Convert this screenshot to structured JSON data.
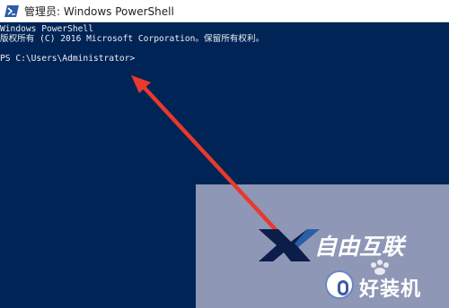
{
  "window": {
    "title": "管理员: Windows PowerShell"
  },
  "console": {
    "lines": [
      "Windows PowerShell",
      "版权所有 (C) 2016 Microsoft Corporation。保留所有权利。",
      "PS C:\\Users\\Administrator>"
    ]
  },
  "watermark": {
    "brand_logo_text": "自由互联",
    "brand2_text": "好装机"
  },
  "colors": {
    "console_bg": "#012456",
    "console_text": "#eeedf0",
    "arrow": "#e8392c",
    "watermark_panel": "#8e97b6"
  },
  "icons": {
    "app_icon": "powershell-icon",
    "arrow_annotation": "red-arrow-icon"
  }
}
